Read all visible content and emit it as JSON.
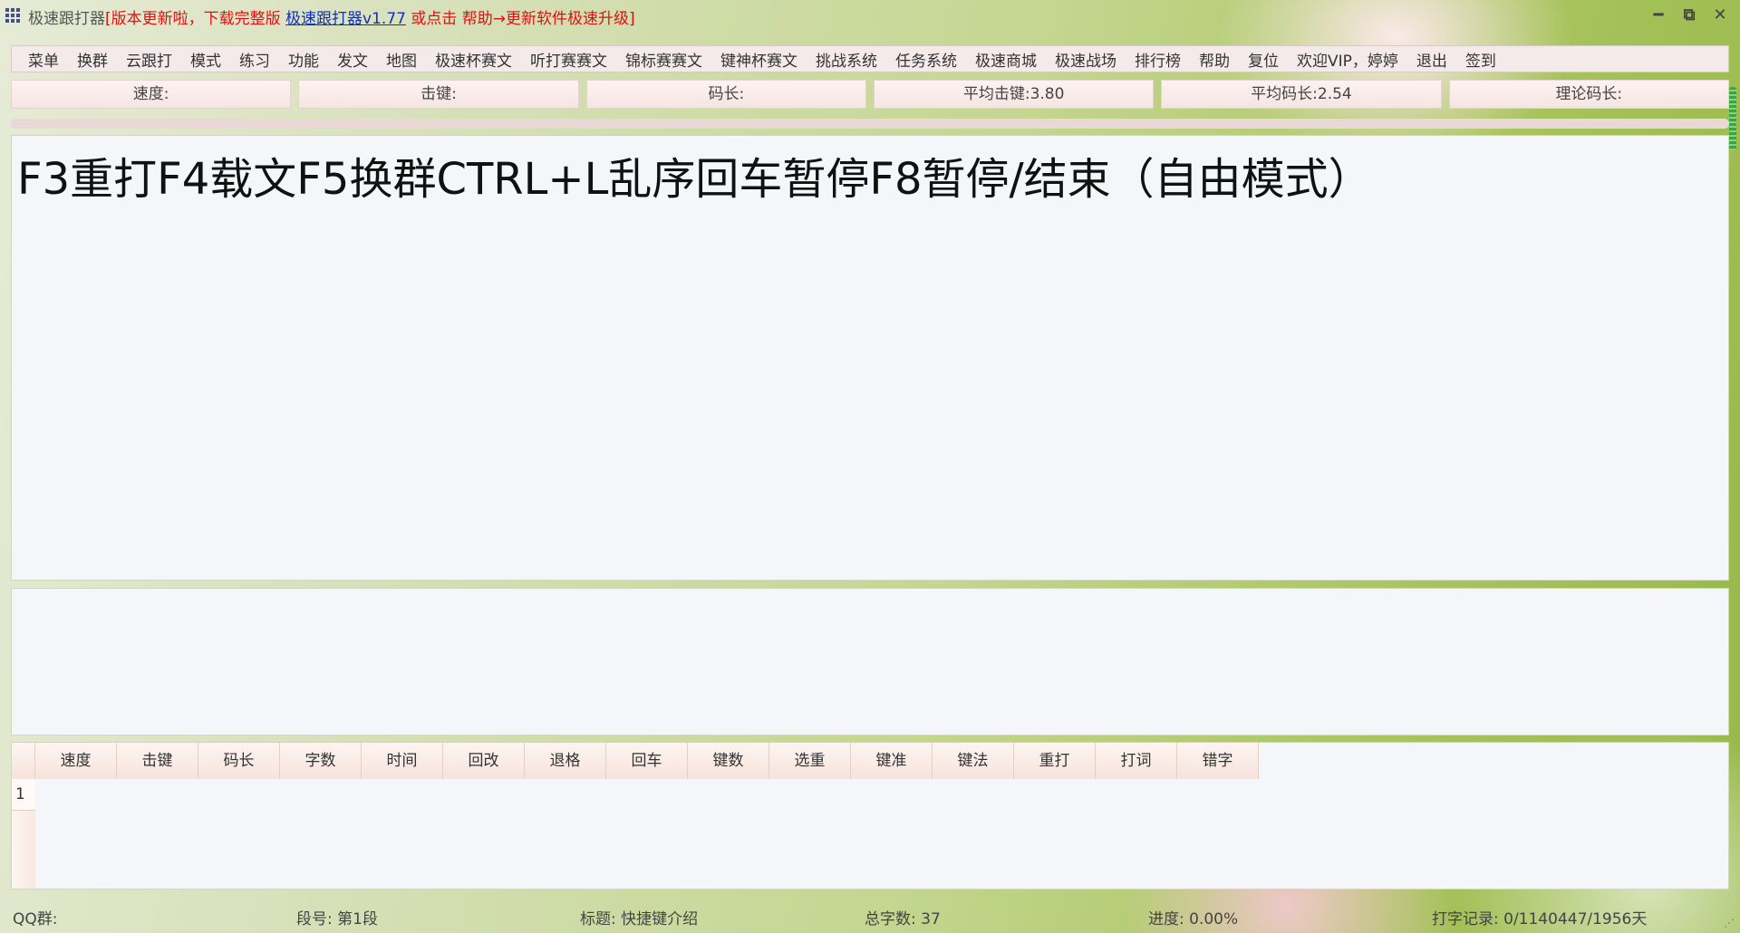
{
  "titlebar": {
    "app_name": "极速跟打器",
    "bracket_open": "[",
    "notice_prefix": "版本更新啦，下载完整版 ",
    "notice_link": "极速跟打器v1.77",
    "notice_suffix": " 或点击 帮助→更新软件极速升级",
    "bracket_close": "]",
    "minimize_glyph": "━",
    "restore_glyph": "⧉",
    "close_glyph": "✕"
  },
  "menu": {
    "items": [
      "菜单",
      "换群",
      "云跟打",
      "模式",
      "练习",
      "功能",
      "发文",
      "地图",
      "极速杯赛文",
      "听打赛赛文",
      "锦标赛赛文",
      "键神杯赛文",
      "挑战系统",
      "任务系统",
      "极速商城",
      "极速战场",
      "排行榜",
      "帮助",
      "复位",
      "欢迎VIP，婷婷",
      "退出",
      "签到"
    ]
  },
  "stats": {
    "speed": "速度:",
    "keystroke": "击键:",
    "code_length": "码长:",
    "avg_keystroke": "平均击键:3.80",
    "avg_code_length": "平均码长:2.54",
    "theory_code_length": "理论码长:"
  },
  "progress": {
    "fraction": 0.0,
    "color": "#ef8b5c"
  },
  "text_panel": {
    "content": "F3重打F4载文F5换群CTRL+L乱序回车暂停F8暂停/结束（自由模式）"
  },
  "grid": {
    "columns": [
      "速度",
      "击键",
      "码长",
      "字数",
      "时间",
      "回改",
      "退格",
      "回车",
      "键数",
      "选重",
      "键准",
      "键法",
      "重打",
      "打词",
      "错字"
    ],
    "rows": [
      "1"
    ]
  },
  "status": {
    "qq_group": "QQ群:",
    "segment": "段号: 第1段",
    "title": "标题: 快捷键介绍",
    "total_chars": "总字数: 37",
    "progress": "进度: 0.00%",
    "record": "打字记录: 0/1140447/1956天",
    "grip": "⋰"
  }
}
